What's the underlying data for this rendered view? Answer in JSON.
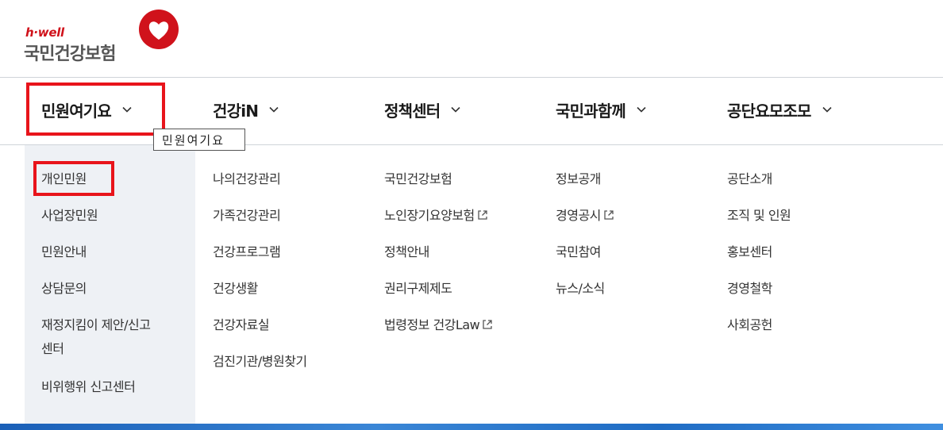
{
  "logo": {
    "en": "h·well",
    "ko": "국민건강보험",
    "brand_color": "#d0121b"
  },
  "gnb": [
    {
      "label": "민원여기요",
      "icon": "chevron-down-icon"
    },
    {
      "label": "건강iN",
      "icon": "chevron-down-icon"
    },
    {
      "label": "정책센터",
      "icon": "chevron-down-icon"
    },
    {
      "label": "국민과함께",
      "icon": "chevron-down-icon"
    },
    {
      "label": "공단요모조모",
      "icon": "chevron-down-icon"
    }
  ],
  "tooltip": "민원여기요",
  "submenu": {
    "col1": [
      "개인민원",
      "사업장민원",
      "민원안내",
      "상담문의",
      "재정지킴이 제안/신고",
      "센터",
      "비위행위 신고센터"
    ],
    "col2": [
      "나의건강관리",
      "가족건강관리",
      "건강프로그램",
      "건강생활",
      "건강자료실",
      "검진기관/병원찾기"
    ],
    "col3": [
      "국민건강보험",
      "노인장기요양보험",
      "정책안내",
      "권리구제제도",
      "법령정보 건강Law"
    ],
    "col4": [
      "정보공개",
      "경영공시",
      "국민참여",
      "뉴스/소식"
    ],
    "col5": [
      "공단소개",
      "조직 및 인원",
      "홍보센터",
      "경영철학",
      "사회공헌"
    ]
  },
  "colors": {
    "highlight": "#e8141b",
    "active_column_bg": "#eef1f5"
  }
}
